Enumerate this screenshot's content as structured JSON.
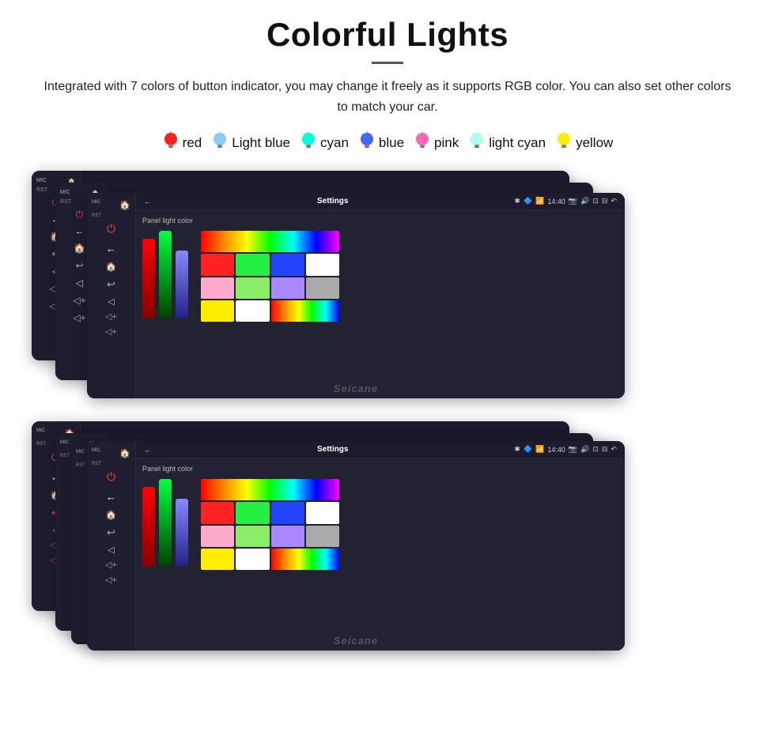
{
  "header": {
    "title": "Colorful Lights",
    "description": "Integrated with 7 colors of button indicator, you may change it freely as it supports RGB color. You can also set other colors to match your car."
  },
  "colors": [
    {
      "name": "red",
      "color": "#ff2222",
      "bulb": "🔴"
    },
    {
      "name": "Light blue",
      "color": "#88ccff",
      "bulb": "🔵"
    },
    {
      "name": "cyan",
      "color": "#00ffee",
      "bulb": "🔵"
    },
    {
      "name": "blue",
      "color": "#2244ff",
      "bulb": "🔵"
    },
    {
      "name": "pink",
      "color": "#ff66cc",
      "bulb": "🔴"
    },
    {
      "name": "light cyan",
      "color": "#aaffee",
      "bulb": "🔵"
    },
    {
      "name": "yellow",
      "color": "#ffee00",
      "bulb": "🟡"
    }
  ],
  "watermark": "Seicane",
  "device": {
    "topbar_title": "Settings",
    "time": "14:40",
    "panel_label": "Panel light color"
  }
}
